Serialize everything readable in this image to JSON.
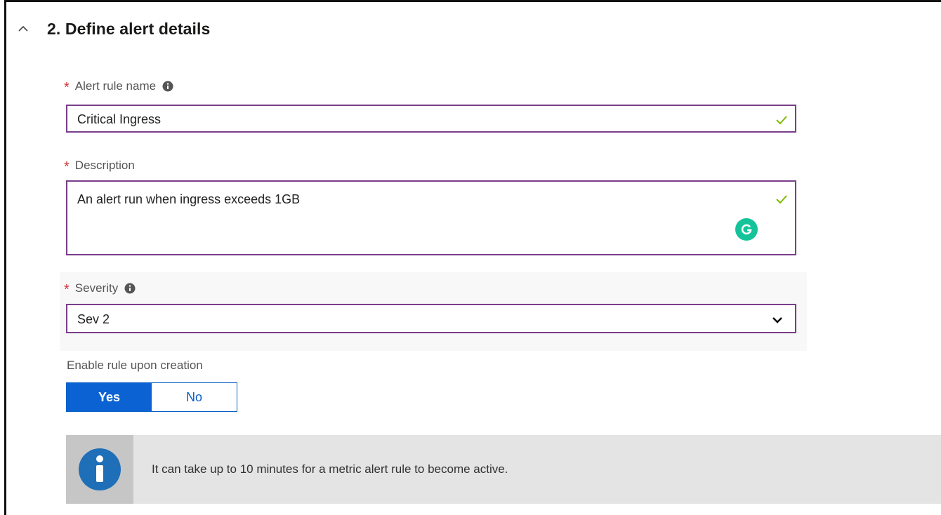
{
  "section": {
    "title": "2. Define alert details",
    "chevron_icon": "chevron-up-icon"
  },
  "alert_rule_name": {
    "required_marker": "*",
    "label": "Alert rule name",
    "value": "Critical Ingress",
    "valid": true
  },
  "description": {
    "required_marker": "*",
    "label": "Description",
    "value": "An alert run when ingress exceeds 1GB",
    "valid": true
  },
  "severity": {
    "required_marker": "*",
    "label": "Severity",
    "selected": "Sev 2"
  },
  "enable_rule": {
    "label": "Enable rule upon creation",
    "yes_label": "Yes",
    "no_label": "No",
    "selected": "Yes"
  },
  "info_banner": {
    "text": "It can take up to 10 minutes for a metric alert rule to become active."
  },
  "colors": {
    "accent": "#0b63d3",
    "field_border": "#7a3e8a",
    "required": "#d13438",
    "valid_check": "#7fba00",
    "grammarly": "#15c39a"
  }
}
